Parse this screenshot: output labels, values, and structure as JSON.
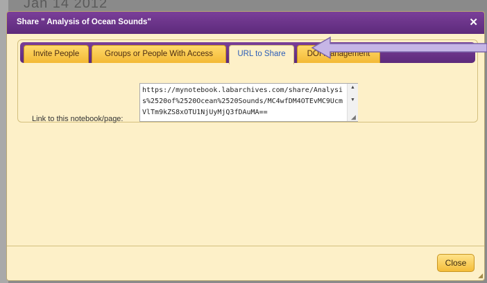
{
  "background": {
    "date_fragment": "Jan 14 2012"
  },
  "dialog": {
    "title": "Share \" Analysis of Ocean Sounds\"",
    "close_icon": "close-icon",
    "tabs": [
      {
        "label": "Invite People",
        "active": false
      },
      {
        "label": "Groups or People With Access",
        "active": false
      },
      {
        "label": "URL to Share",
        "active": true
      },
      {
        "label": "DOI Management",
        "active": false
      }
    ],
    "link_label": "Link to this notebook/page:",
    "url_value": "https://mynotebook.labarchives.com/share/Analysis%2520of%2520Ocean%2520Sounds/MC4wfDM4OTEvMC9UcmVlTm9kZS8xOTU1NjUyMjQ3fDAuMA==",
    "close_button": "Close"
  },
  "colors": {
    "title_bar": "#6a3589",
    "tab_gold": "#f3b935",
    "dialog_bg": "#fdf0c8",
    "active_tab_text": "#2b5db8",
    "annotation_arrow": "#c6b6e6"
  }
}
